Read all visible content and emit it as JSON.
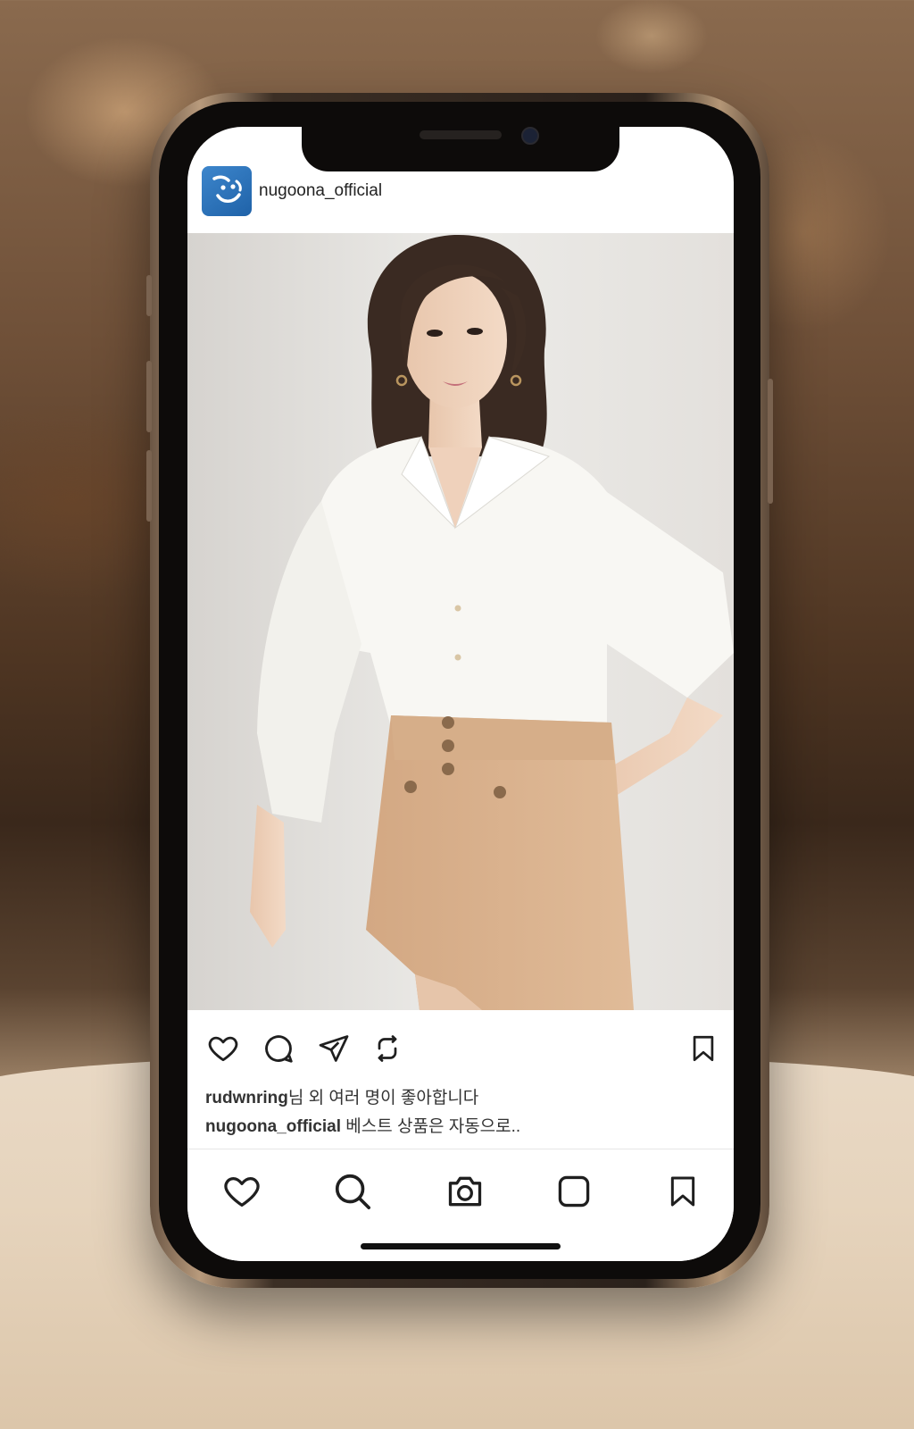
{
  "post": {
    "username": "nugoona_official",
    "avatar_icon": "smiley-logo-icon",
    "photo_subject": ""
  },
  "actions": {
    "icons": [
      "heart-icon",
      "comment-icon",
      "share-icon",
      "repost-icon",
      "bookmark-icon"
    ]
  },
  "likes": {
    "user": "rudwnring",
    "rest": "님 외 여러 명이 좋아합니다"
  },
  "caption": {
    "user": "nugoona_official",
    "text": " 베스트 상품은 자동으로.."
  },
  "tabbar": {
    "icons": [
      "heart-icon",
      "search-icon",
      "camera-icon",
      "square-icon",
      "bookmark-icon"
    ]
  },
  "colors": {
    "avatar": "#2f78c0",
    "icon_stroke": "#1f1f1f",
    "shorts": "#d8b08c",
    "shirt": "#f8f7f3"
  }
}
